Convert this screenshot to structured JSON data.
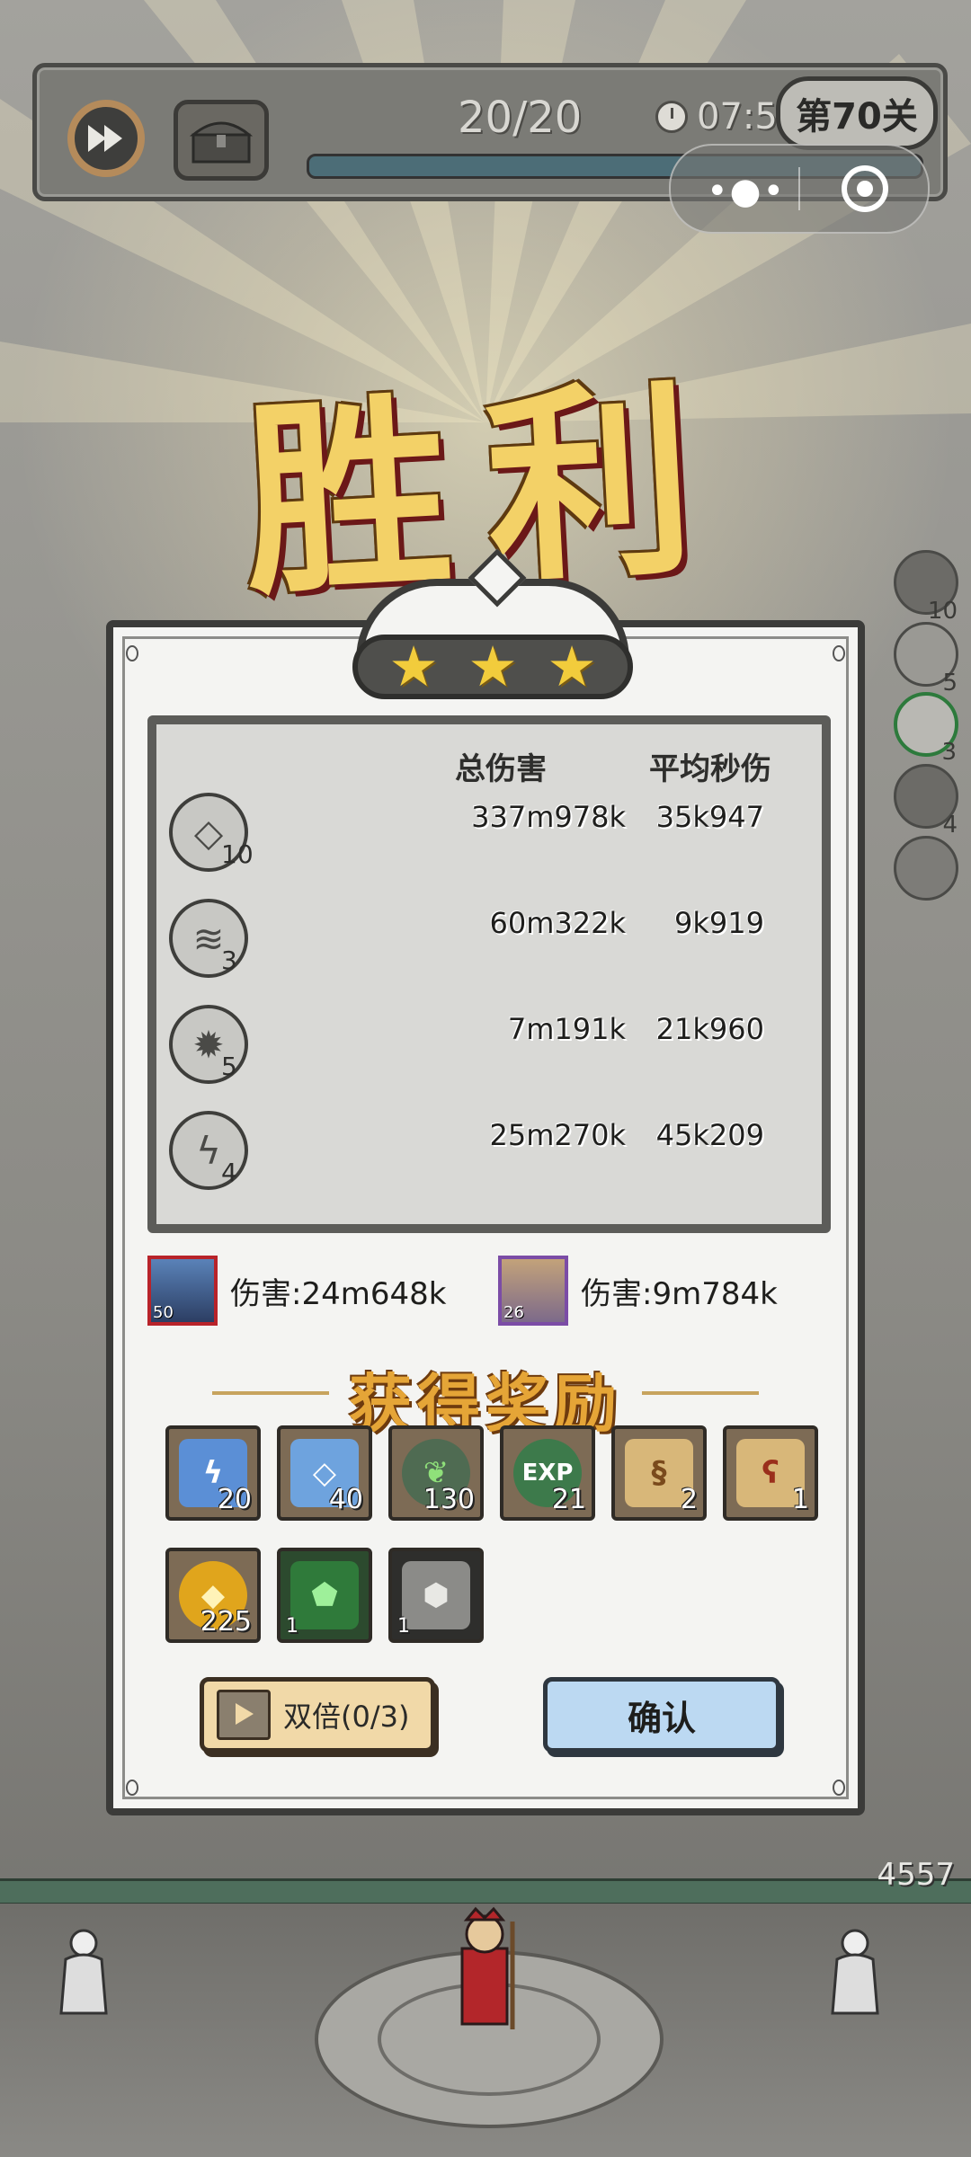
{
  "hud": {
    "wave_count": "20/20",
    "timer": "07:56",
    "level": "第70关",
    "fast_forward_icon": "fast-forward-icon",
    "chest_icon": "treasure-chest-icon",
    "menu_dots": "•●•"
  },
  "victory_title": "胜利",
  "stars": [
    "★",
    "★",
    "★"
  ],
  "stats": {
    "col_total": "总伤害",
    "col_dps": "平均秒伤",
    "rows": [
      {
        "icon": "crystal-shard-icon",
        "glyph": "◇",
        "level": "10",
        "total": "337m978k",
        "dps": "35k947"
      },
      {
        "icon": "tornado-icon",
        "glyph": "≋",
        "level": "3",
        "total": "60m322k",
        "dps": "9k919"
      },
      {
        "icon": "ice-crystal-icon",
        "glyph": "✹",
        "level": "5",
        "total": "7m191k",
        "dps": "21k960"
      },
      {
        "icon": "lightning-icon",
        "glyph": "ϟ",
        "level": "4",
        "total": "25m270k",
        "dps": "45k209"
      }
    ]
  },
  "heroes": [
    {
      "level": "50",
      "damage": "伤害:24m648k"
    },
    {
      "level": "26",
      "damage": "伤害:9m784k"
    }
  ],
  "reward_title": "获得奖励",
  "rewards": [
    {
      "icon": "ice-lightning-icon",
      "glyph": "ϟ",
      "qty": "20",
      "color": "#5b8fd6"
    },
    {
      "icon": "ice-shard-icon",
      "glyph": "◇",
      "qty": "40",
      "color": "#6ea3de"
    },
    {
      "icon": "green-leaf-emblem-icon",
      "glyph": "❦",
      "qty": "130",
      "color": "#4f6b52"
    },
    {
      "icon": "exp-orb-icon",
      "glyph": "EXP",
      "qty": "21",
      "color": "#3d7a4b"
    },
    {
      "icon": "scroll-amulet-icon",
      "glyph": "§",
      "qty": "2",
      "color": "#d8b779"
    },
    {
      "icon": "scroll-rune-icon",
      "glyph": "ʕ",
      "qty": "1",
      "color": "#d8b779"
    },
    {
      "icon": "gold-coin-icon",
      "glyph": "◆",
      "qty": "225",
      "color": "#e0a51c"
    },
    {
      "icon": "green-gem-icon",
      "glyph": "⬟",
      "qty": "1",
      "color": "#2f7a3a"
    },
    {
      "icon": "silver-ore-icon",
      "glyph": "⬢",
      "qty": "1",
      "color": "#8b8b88"
    }
  ],
  "buttons": {
    "double": "双倍(0/3)",
    "confirm": "确认"
  },
  "side_icons": [
    {
      "icon": "side-skill-1-icon",
      "num": "10"
    },
    {
      "icon": "side-skill-2-icon",
      "num": "5"
    },
    {
      "icon": "side-skill-3-icon",
      "num": "3"
    },
    {
      "icon": "side-skill-4-icon",
      "num": "4"
    },
    {
      "icon": "side-skill-5-icon",
      "num": ""
    }
  ],
  "ground_value": "4557"
}
